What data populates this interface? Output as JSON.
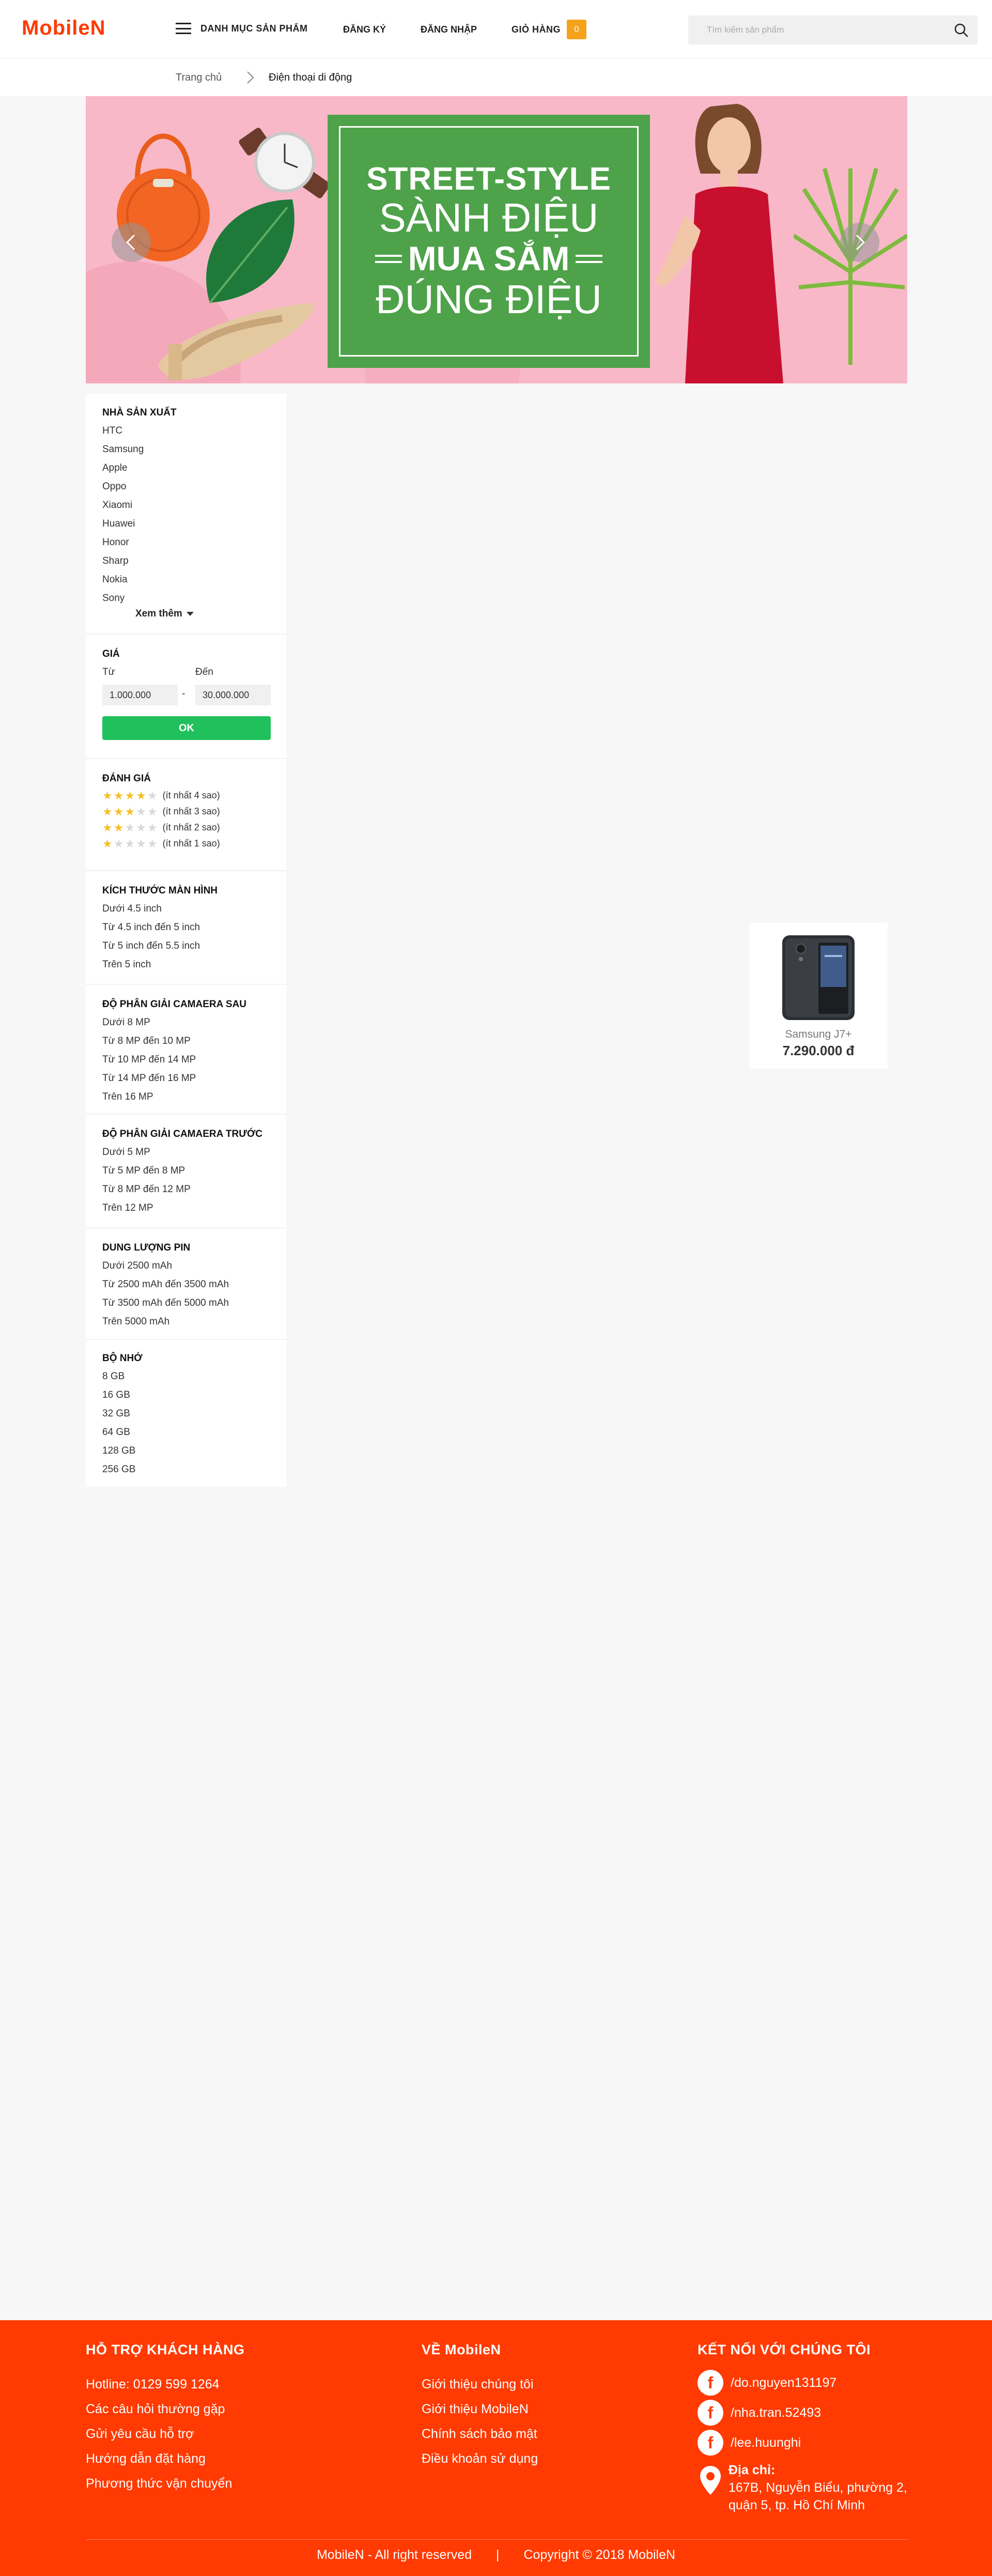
{
  "header": {
    "logo": "MobileN",
    "menu_label": "DANH MỤC SẢN PHẨM",
    "register": "ĐĂNG KÝ",
    "login": "ĐĂNG NHẬP",
    "cart_label": "GIỎ HÀNG",
    "cart_count": "0",
    "search_placeholder": "Tìm kiếm sản phẩm"
  },
  "breadcrumb": {
    "home": "Trang chủ",
    "current": "Điện thoại di động"
  },
  "banner": {
    "line1": "STREET-STYLE",
    "line2": "SÀNH ĐIỆU",
    "line3": "MUA SẮM",
    "line4": "ĐÚNG ĐIỆU",
    "accent_color": "#4ea24a",
    "background_color": "#f8b8c8"
  },
  "filters": {
    "manufacturer": {
      "title": "NHÀ SẢN XUẤT",
      "items": [
        "HTC",
        "Samsung",
        "Apple",
        "Oppo",
        "Xiaomi",
        "Huawei",
        "Honor",
        "Sharp",
        "Nokia",
        "Sony"
      ],
      "more_label": "Xem thêm"
    },
    "price": {
      "title": "GIÁ",
      "from_label": "Từ",
      "to_label": "Đến",
      "from_value": "1.000.000",
      "to_value": "30.000.000",
      "separator": "-",
      "ok_label": "OK"
    },
    "rating": {
      "title": "ĐÁNH GIÁ",
      "items": [
        {
          "stars": 4,
          "label": "(ít nhất 4 sao)"
        },
        {
          "stars": 3,
          "label": "(ít nhất 3 sao)"
        },
        {
          "stars": 2,
          "label": "(ít nhất 2 sao)"
        },
        {
          "stars": 1,
          "label": "(ít nhất 1 sao)"
        }
      ]
    },
    "screen": {
      "title": "KÍCH THƯỚC MÀN HÌNH",
      "items": [
        "Dưới 4.5 inch",
        "Từ 4.5 inch đến 5 inch",
        "Từ 5 inch đến 5.5 inch",
        "Trên 5 inch"
      ]
    },
    "rear_camera": {
      "title": "ĐỘ PHÂN GIẢI CAMAERA SAU",
      "items": [
        "Dưới 8 MP",
        "Từ 8 MP đến 10 MP",
        "Từ 10 MP đến 14 MP",
        "Từ 14 MP đến 16 MP",
        "Trên 16 MP"
      ]
    },
    "front_camera": {
      "title": "ĐỘ PHÂN GIẢI CAMAERA TRƯỚC",
      "items": [
        "Dưới 5 MP",
        "Từ 5 MP đến 8 MP",
        "Từ 8 MP đến 12 MP",
        "Trên 12 MP"
      ]
    },
    "battery": {
      "title": "DUNG LƯỢNG PIN",
      "items": [
        "Dưới 2500 mAh",
        "Từ 2500 mAh đến 3500 mAh",
        "Từ 3500 mAh đến 5000 mAh",
        "Trên 5000 mAh"
      ]
    },
    "memory": {
      "title": "BỘ NHỚ",
      "items": [
        "8 GB",
        "16 GB",
        "32 GB",
        "64 GB",
        "128 GB",
        "256 GB"
      ]
    }
  },
  "products": [
    {
      "name": "Samsung J7+",
      "price": "7.290.000 đ"
    }
  ],
  "footer": {
    "support": {
      "title": "HỖ TRỢ KHÁCH HÀNG",
      "links": [
        "Hotline: 0129 599 1264",
        "Các câu hỏi thường gặp",
        "Gửi yêu cầu hỗ trợ",
        "Hướng dẫn đặt hàng",
        "Phương thức vận chuyển"
      ]
    },
    "about": {
      "title": "VỀ MobileN",
      "links": [
        "Giới thiệu chúng tôi",
        "Giới thiệu MobileN",
        "Chính sách bảo mật",
        "Điều khoản sử dụng"
      ]
    },
    "connect": {
      "title": "KẾT NỐI VỚI CHÚNG TÔI",
      "facebook": [
        "/do.nguyen131197",
        "/nha.tran.52493",
        "/lee.huunghi"
      ],
      "address_label": "Địa chỉ:",
      "address_line1": "167B, Nguyễn Biểu, phường 2,",
      "address_line2": "quận 5, tp. Hồ Chí Minh"
    },
    "bottom_left": "MobileN - All right reserved",
    "bottom_sep": "|",
    "bottom_right": "Copyright © 2018 MobileN",
    "background_color": "#ff3a02"
  }
}
